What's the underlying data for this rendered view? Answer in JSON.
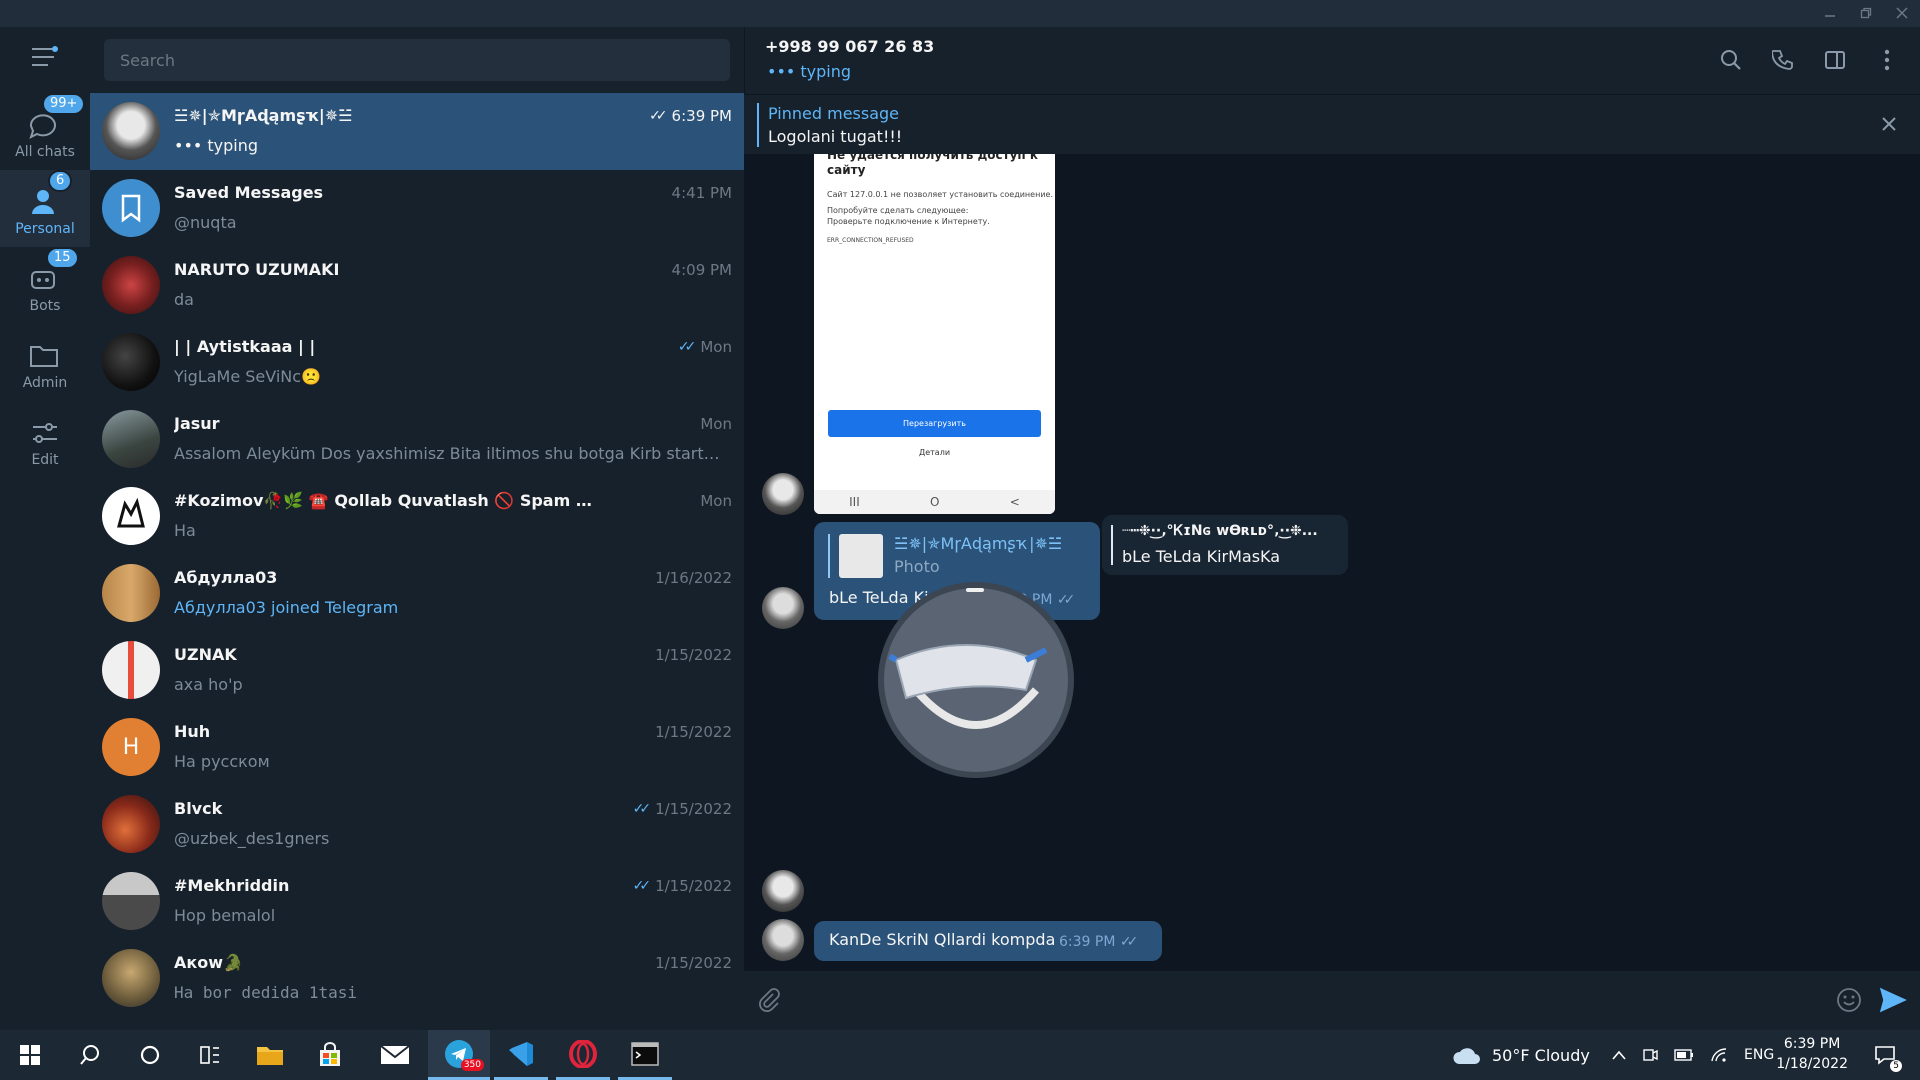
{
  "window": {
    "controls": [
      "minimize",
      "restore",
      "close"
    ]
  },
  "rail": {
    "folders": [
      {
        "label": "All chats",
        "badge": "99+"
      },
      {
        "label": "Personal",
        "badge": "6"
      },
      {
        "label": "Bots",
        "badge": "15"
      },
      {
        "label": "Admin",
        "badge": ""
      },
      {
        "label": "Edit",
        "badge": ""
      }
    ]
  },
  "search": {
    "placeholder": "Search"
  },
  "chats": [
    {
      "name": "☱✵|✯MɼAɖąmʂҡ|✵☱",
      "message": "••• typing",
      "time": "6:39 PM",
      "read": true,
      "selected": true
    },
    {
      "name": "Saved Messages",
      "message": "@nuqta",
      "time": "4:41 PM",
      "read": false
    },
    {
      "name": "NARUTO UZUMAKI",
      "message": "da",
      "time": "4:09 PM",
      "read": false
    },
    {
      "name": "| | Aytistkaaa | |",
      "message": "YigLaMe SeViNc🙁",
      "time": "Mon",
      "read": true
    },
    {
      "name": "Jasur",
      "message": "Assalom Aleyküm Dos yaxshimisz Bita iltimos shu botga Kirb start bosib ...",
      "time": "Mon",
      "read": false
    },
    {
      "name": "#Kozimov🥀🌿 ☎️ Qollab Quvatlash 🚫 Spam Bolsangiz 🤖 @Ko...",
      "message": "На",
      "time": "Mon",
      "read": false
    },
    {
      "name": "Абдулла03",
      "message": "Абдулла03 joined Telegram",
      "time": "1/16/2022",
      "read": false,
      "link": true
    },
    {
      "name": "UZNAK",
      "message": "axa ho'p",
      "time": "1/15/2022",
      "read": false
    },
    {
      "name": "Huh",
      "message": "На русском",
      "time": "1/15/2022",
      "read": false,
      "initial": "H"
    },
    {
      "name": "Blvck",
      "message": "@uzbek_des1gners",
      "time": "1/15/2022",
      "read": true
    },
    {
      "name": "#Mekhriddin",
      "message": "Hop bemalol",
      "time": "1/15/2022",
      "read": true
    },
    {
      "name": "Акоw🐊",
      "message": "Ha bor dedida 1tasi",
      "time": "1/15/2022",
      "read": false
    }
  ],
  "conversation": {
    "title": "+998 99 067 26 83",
    "status": "••• typing",
    "pinned": {
      "title": "Pinned message",
      "text": "Logolani tugat!!!"
    },
    "photo": {
      "heading": "Не удается получить доступ к сайту",
      "lines": [
        "Сайт 127.0.0.1 не позволяет установить соединение.",
        "Попробуйте сделать следующее:",
        "Проверьте подключение к Интернету.",
        "ERR_CONNECTION_REFUSED"
      ],
      "button": "Перезагрузить",
      "link": "Детали",
      "nav": [
        "III",
        "O",
        "<"
      ]
    },
    "messages": [
      {
        "reply_name": "☱✵|✯MɼAɖąmʂҡ|✵☱",
        "reply_sub": "Photo",
        "text": "bLe TeLda KirMasKa",
        "time": "6:38 PM"
      },
      {
        "reply_name": "┈┅❉·͜·‚°ᏦɪNɢ ᴡӨʀʟᴅ°‚·͜·❉...",
        "text": "bLe TeLda KirMasKa"
      },
      {
        "text": "KanDe SkriN Qllardi kompda",
        "time": "6:39 PM"
      }
    ]
  },
  "composer": {
    "placeholder": ""
  },
  "taskbar": {
    "telegram_badge": "350",
    "weather": "50°F  Cloudy",
    "lang": "ENG",
    "time": "6:39 PM",
    "date": "1/18/2022",
    "notifications": "5"
  }
}
